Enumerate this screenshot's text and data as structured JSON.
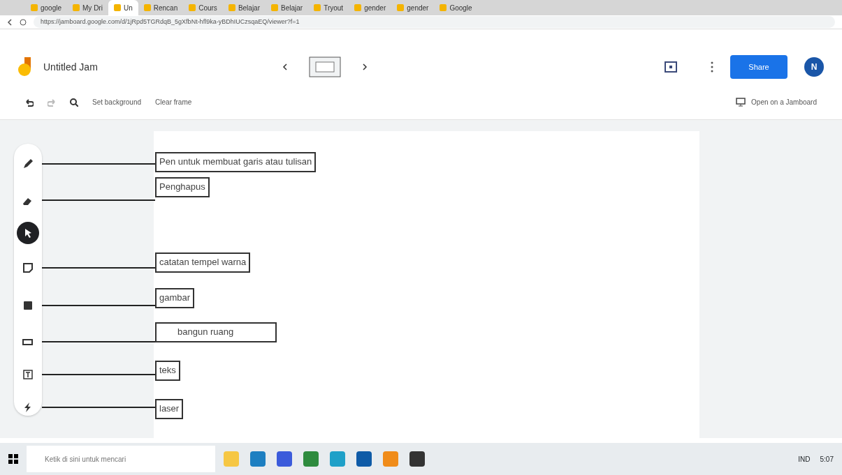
{
  "browser": {
    "tabs": [
      {
        "label": "google",
        "selected": false
      },
      {
        "label": "My Dri",
        "selected": false
      },
      {
        "label": "Un",
        "selected": true
      },
      {
        "label": "Rencan",
        "selected": false
      },
      {
        "label": "Cours",
        "selected": false
      },
      {
        "label": "Belajar",
        "selected": false
      },
      {
        "label": "Belajar",
        "selected": false
      },
      {
        "label": "Tryout",
        "selected": false
      },
      {
        "label": "gender",
        "selected": false
      },
      {
        "label": "gender",
        "selected": false
      },
      {
        "label": "Google",
        "selected": false
      }
    ],
    "url": "https://jamboard.google.com/d/1jRpd5TGRdqB_5gXfbNt-hfl9ka-yBDhIUCzsqaEQ/viewer?f=1"
  },
  "app": {
    "title": "Untitled Jam",
    "share": "Share",
    "avatar": "N"
  },
  "toolbar": {
    "set_background": "Set background",
    "clear_frame": "Clear frame",
    "open_on_jamboard": "Open on a Jamboard"
  },
  "tools": [
    {
      "kind": "pen",
      "selected": false,
      "annotation": "Pen untuk membuat garis atau tulisan"
    },
    {
      "kind": "eraser",
      "selected": false,
      "annotation": "Penghapus"
    },
    {
      "kind": "select",
      "selected": true
    },
    {
      "kind": "sticky",
      "selected": false,
      "annotation": "catatan tempel warna"
    },
    {
      "kind": "image",
      "selected": false,
      "annotation": "gambar"
    },
    {
      "kind": "shape",
      "selected": false,
      "annotation": "bangun ruang"
    },
    {
      "kind": "text",
      "selected": false,
      "annotation": "teks"
    },
    {
      "kind": "laser",
      "selected": false,
      "annotation": "laser"
    }
  ],
  "taskbar": {
    "search_placeholder": "Ketik di sini untuk mencari",
    "tray_language": "IND",
    "time": "5:07"
  }
}
